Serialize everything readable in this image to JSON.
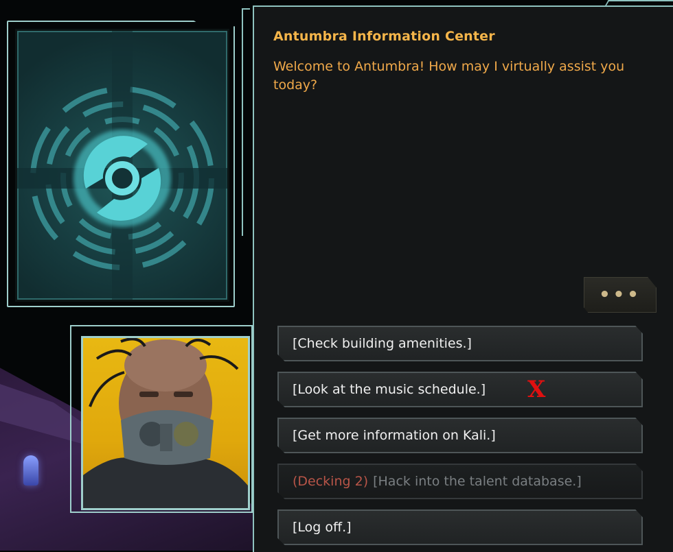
{
  "dialogue": {
    "speaker": "Antumbra Information Center",
    "message": "Welcome to Antumbra! How may I virtually assist you today?",
    "more_button": "•••"
  },
  "options": [
    {
      "label": "[Check building amenities.]",
      "disabled": false
    },
    {
      "label": "[Look at the music schedule.]",
      "disabled": false,
      "marked": "X"
    },
    {
      "label": "[Get more information on Kali.]",
      "disabled": false
    },
    {
      "requirement": "(Decking 2)",
      "label": "[Hack into the talent database.]",
      "disabled": true
    },
    {
      "label": "[Log off.]",
      "disabled": false
    }
  ],
  "colors": {
    "speaker": "#f5b54a",
    "message": "#f0a94a",
    "option_text": "#f0f0f0",
    "disabled_text": "#7a7f82",
    "requirement_text": "#b85548",
    "frame_accent": "#9fcfcc",
    "annotation_mark": "#e01010"
  },
  "icons": {
    "card": "target-rings-icon",
    "more": "ellipsis-icon"
  }
}
